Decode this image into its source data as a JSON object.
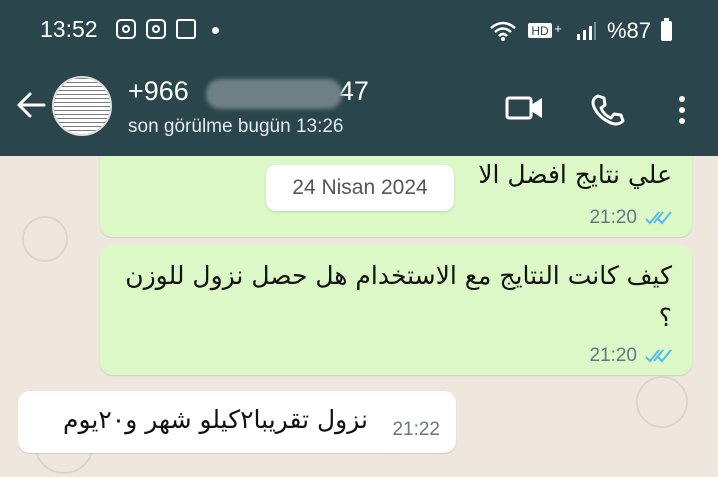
{
  "status_bar": {
    "time": "13:52",
    "battery": "%87",
    "icons": [
      "instagram-icon",
      "instagram-icon",
      "image-icon",
      "notification-dot-icon",
      "wifi-icon",
      "hd-plus-icon",
      "signal-icon",
      "battery-icon"
    ]
  },
  "header": {
    "contact_visible_prefix": "+966",
    "contact_visible_suffix": "47",
    "last_seen": "son görülme bugün 13:26",
    "icons": [
      "back-icon",
      "video-call-icon",
      "voice-call-icon",
      "more-vert-icon"
    ]
  },
  "chat": {
    "date_label": "24 Nisan 2024",
    "messages": [
      {
        "direction": "outgoing",
        "text": "علي نتايج افضل الا",
        "time": "21:20",
        "status": "read"
      },
      {
        "direction": "outgoing",
        "text": "كيف كانت النتايج مع الاستخدام هل حصل نزول للوزن ؟",
        "time": "21:20",
        "status": "read"
      },
      {
        "direction": "incoming",
        "text": "نزول تقريبا٢كيلو شهر و٢٠يوم",
        "time": "21:22"
      }
    ]
  },
  "colors": {
    "header_bg": "#2a454b",
    "chat_bg": "#efe7de",
    "outgoing_bubble": "#dcf8c6",
    "incoming_bubble": "#ffffff",
    "read_tick": "#53bdeb"
  }
}
